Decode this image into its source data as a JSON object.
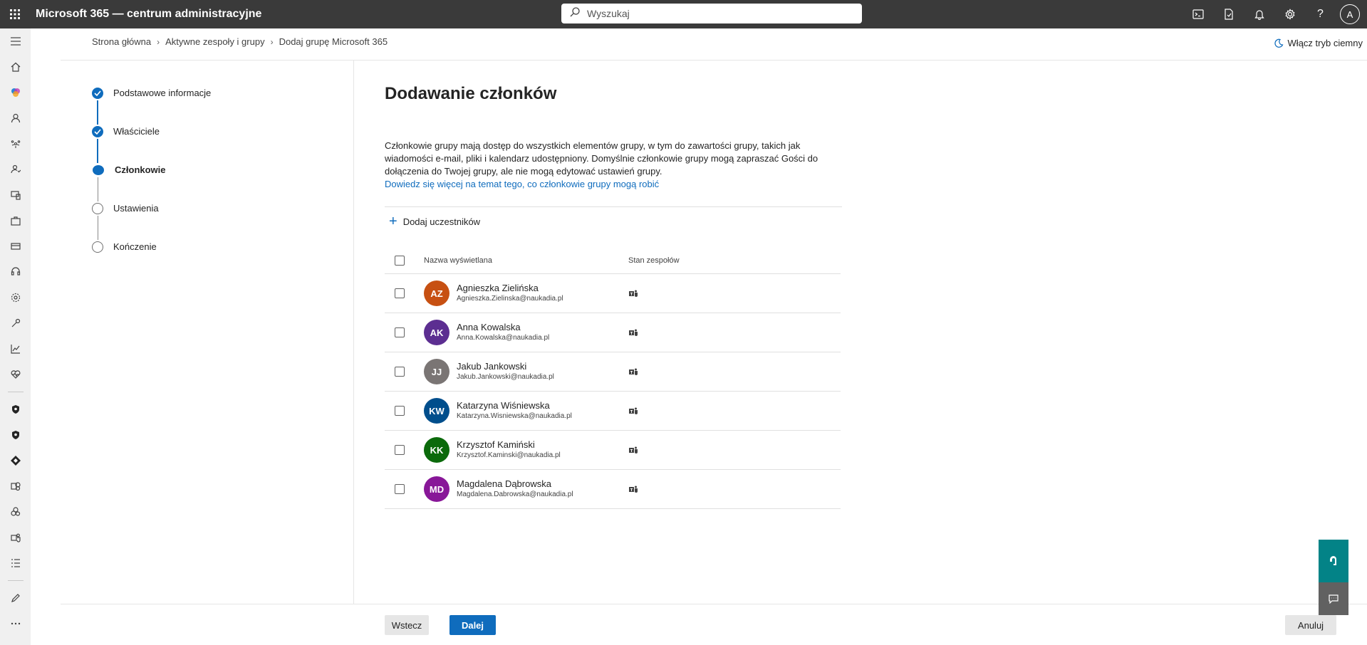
{
  "app": {
    "title": "Microsoft 365 — centrum administracyjne",
    "user_initial": "A"
  },
  "search": {
    "placeholder": "Wyszukaj"
  },
  "breadcrumb": [
    "Strona główna",
    "Aktywne zespoły i grupy",
    "Dodaj grupę Microsoft 365"
  ],
  "dark_mode_label": "Włącz tryb ciemny",
  "steps": [
    {
      "label": "Podstawowe informacje",
      "state": "done"
    },
    {
      "label": "Właściciele",
      "state": "done"
    },
    {
      "label": "Członkowie",
      "state": "current"
    },
    {
      "label": "Ustawienia",
      "state": "todo"
    },
    {
      "label": "Kończenie",
      "state": "todo"
    }
  ],
  "main": {
    "title": "Dodawanie członków",
    "description": "Członkowie grupy mają dostęp do wszystkich elementów grupy, w tym do zawartości grupy, takich jak wiadomości e-mail, pliki i kalendarz udostępniony. Domyślnie członkowie grupy mogą zapraszać Gości do dołączenia do Twojej grupy, ale nie mogą edytować ustawień grupy.",
    "link": "Dowiedz się więcej na temat tego, co członkowie grupy mogą robić",
    "add_label": "Dodaj uczestników"
  },
  "table": {
    "headers": {
      "name": "Nazwa wyświetlana",
      "teams": "Stan zespołów"
    },
    "rows": [
      {
        "initials": "AZ",
        "name": "Agnieszka Zielińska",
        "email": "Agnieszka.Zielinska@naukadia.pl",
        "color": "#c75012"
      },
      {
        "initials": "AK",
        "name": "Anna Kowalska",
        "email": "Anna.Kowalska@naukadia.pl",
        "color": "#5c2e91"
      },
      {
        "initials": "JJ",
        "name": "Jakub Jankowski",
        "email": "Jakub.Jankowski@naukadia.pl",
        "color": "#7a7574"
      },
      {
        "initials": "KW",
        "name": "Katarzyna Wiśniewska",
        "email": "Katarzyna.Wisniewska@naukadia.pl",
        "color": "#004e8c"
      },
      {
        "initials": "KK",
        "name": "Krzysztof Kamiński",
        "email": "Krzysztof.Kaminski@naukadia.pl",
        "color": "#0b6a0b"
      },
      {
        "initials": "MD",
        "name": "Magdalena Dąbrowska",
        "email": "Magdalena.Dabrowska@naukadia.pl",
        "color": "#881798"
      }
    ]
  },
  "footer": {
    "back": "Wstecz",
    "next": "Dalej",
    "cancel": "Anuluj"
  },
  "colors": {
    "accent": "#0f6cbd",
    "topbar": "#3a3a3a",
    "float_help": "#038387"
  }
}
